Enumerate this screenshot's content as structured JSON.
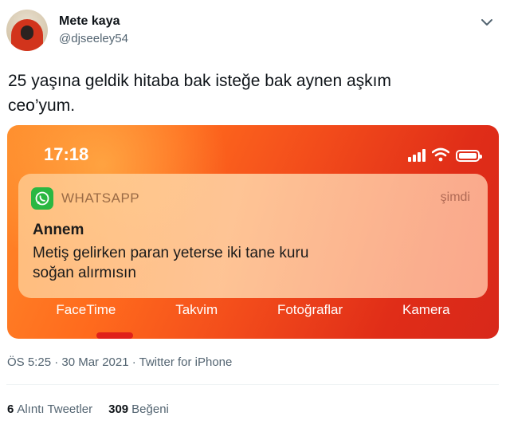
{
  "author": {
    "name": "Mete kaya",
    "handle": "@djseeley54"
  },
  "tweet": {
    "text_line1": "25 yaşına geldik hitaba bak isteğe bak aynen aşkım",
    "text_line2": "ceo’yum."
  },
  "media": {
    "time": "17:18",
    "notification": {
      "app": "WHATSAPP",
      "when": "şimdi",
      "sender": "Annem",
      "message_line1": "Metiş gelirken paran yeterse iki tane kuru",
      "message_line2": "soğan alırmısın"
    },
    "dock": [
      "FaceTime",
      "Takvim",
      "Fotoğraflar",
      "Kamera"
    ]
  },
  "meta": {
    "time_line": "ÖS 5:25 · 30 Mar 2021 · Twitter for iPhone"
  },
  "stats": {
    "quotes_count": "6",
    "quotes_label": "Alıntı Tweetler",
    "likes_count": "309",
    "likes_label": "Beğeni"
  },
  "icons": {
    "more": "chevron-down-icon",
    "whatsapp": "whatsapp-icon",
    "signal": "signal-icon",
    "wifi": "wifi-icon",
    "battery": "battery-icon"
  },
  "colors": {
    "whatsapp_green": "#2bb742",
    "media_orange": "#ff6a1d",
    "text_secondary": "#536471"
  }
}
